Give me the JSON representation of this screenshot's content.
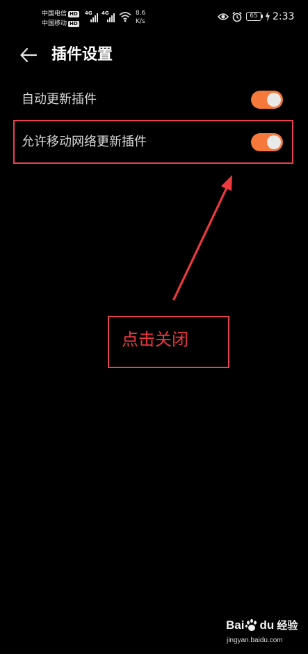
{
  "status_bar": {
    "carrier_1": "中国电信",
    "carrier_2": "中国移动",
    "hd_label": "HD",
    "network_type_1": "4G",
    "network_type_2": "4G",
    "net_speed_value": "8.6",
    "net_speed_unit": "K/s",
    "battery_level": "65",
    "time": "2:33",
    "icons": [
      "signal-icon",
      "wifi-icon",
      "eye-icon",
      "alarm-icon",
      "battery-icon",
      "charging-icon"
    ]
  },
  "header": {
    "back_icon": "back-arrow-icon",
    "title": "插件设置"
  },
  "settings": [
    {
      "label": "自动更新插件",
      "enabled": true
    },
    {
      "label": "允许移动网络更新插件",
      "enabled": true
    }
  ],
  "annotation": {
    "callout_text": "点击关闭",
    "color": "#e8424c"
  },
  "colors": {
    "background": "#000000",
    "toggle_on": "#f5793a",
    "toggle_knob": "#e9e9e9",
    "annotation_red": "#e8424c"
  },
  "watermark": {
    "brand_bai": "Bai",
    "brand_du": "du",
    "brand_jingyan": "经验",
    "url": "jingyan.baidu.com"
  }
}
